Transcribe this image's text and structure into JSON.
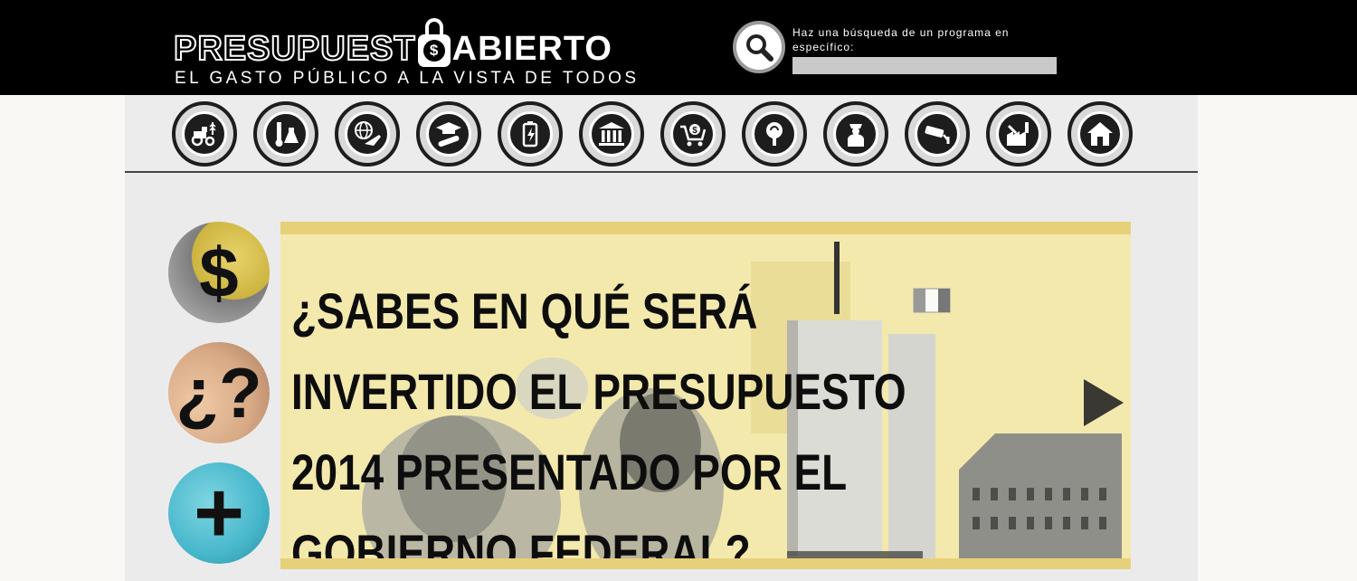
{
  "header": {
    "logo": {
      "part1": "PRESUPUEST",
      "lock_symbol": "$",
      "part2": "ABIERTO",
      "tagline": "EL GASTO PÚBLICO A LA VISTA DE TODOS"
    },
    "search": {
      "hint": "Haz una búsqueda de un programa en específico:",
      "value": "",
      "icon": "search-icon"
    }
  },
  "categories": [
    {
      "name": "agriculture",
      "icon": "tractor-wheat-icon"
    },
    {
      "name": "science",
      "icon": "thermometer-flask-icon"
    },
    {
      "name": "international",
      "icon": "globe-plane-icon"
    },
    {
      "name": "education",
      "icon": "graduation-cap-diploma-icon"
    },
    {
      "name": "energy",
      "icon": "battery-bolt-icon"
    },
    {
      "name": "government",
      "icon": "government-building-icon"
    },
    {
      "name": "economy",
      "icon": "shopping-cart-money-icon"
    },
    {
      "name": "environment",
      "icon": "recycle-tree-icon"
    },
    {
      "name": "security",
      "icon": "police-officer-icon"
    },
    {
      "name": "surveillance",
      "icon": "security-camera-icon"
    },
    {
      "name": "industry",
      "icon": "factory-wrench-icon"
    },
    {
      "name": "housing",
      "icon": "house-icon"
    }
  ],
  "side_buttons": [
    {
      "glyph": "$",
      "icon": "dollar-icon"
    },
    {
      "glyph": "¿?",
      "icon": "question-icon"
    },
    {
      "glyph": "+",
      "icon": "plus-icon"
    }
  ],
  "banner": {
    "headline_lines": [
      "¿SABES EN QUÉ SERÁ",
      "INVERTIDO EL PRESUPUESTO",
      "2014 PRESENTADO POR EL",
      "GOBIERNO FEDERAL?"
    ],
    "next_icon": "play-arrow-icon"
  },
  "colors": {
    "header_bg": "#000000",
    "banner_bg": "#f3e9ad",
    "banner_border": "#e7d07a",
    "icon_dark": "#1d1d1d"
  }
}
